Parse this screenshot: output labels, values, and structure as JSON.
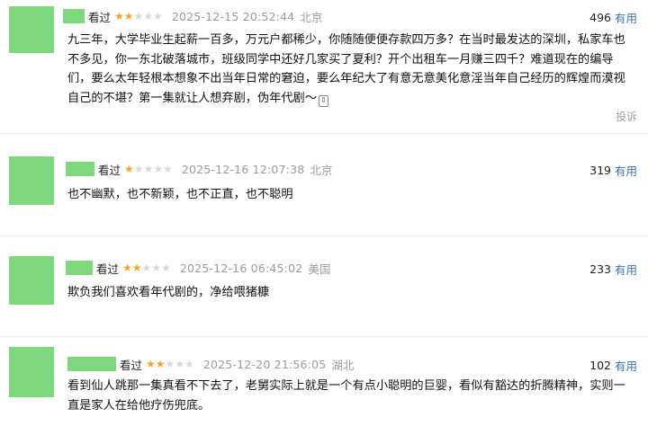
{
  "reviews": [
    {
      "status": "看过",
      "rating": 2,
      "time": "2025-12-15 20:52:44",
      "location": "北京",
      "votes": "496",
      "useful_label": "有用",
      "lines": [
        "九三年，大学毕业生起薪一百多，万元户都稀少，你随随便便存款四万多？在当时最发达的深圳，私家车也",
        "不多见，你一东北破落城市，班级同学中还好几家买了夏利？开个出租车一月赚三四千？难道现在的编导",
        "们，要么太年轻根本想象不出当年日常的窘迫，要么年纪大了有意无意美化意淫当年自己经历的辉煌而漠视",
        "自己的不堪？第一集就让人想弃剧，伪年代剧～"
      ],
      "report_label": "投诉"
    },
    {
      "status": "看过",
      "rating": 1,
      "time": "2025-12-16 12:07:38",
      "location": "北京",
      "votes": "319",
      "useful_label": "有用",
      "lines": [
        "也不幽默，也不新颖，也不正直，也不聪明"
      ]
    },
    {
      "status": "看过",
      "rating": 2,
      "time": "2025-12-16 06:45:02",
      "location": "美国",
      "votes": "233",
      "useful_label": "有用",
      "lines": [
        "欺负我们喜欢看年代剧的，净给喂猪糠"
      ]
    },
    {
      "status": "看过",
      "rating": 2,
      "time": "2025-12-20 21:56:05",
      "location": "湖北",
      "votes": "102",
      "useful_label": "有用",
      "lines": [
        "看到仙人跳那一集真看不下去了，老舅实际上就是一个有点小聪明的巨婴，看似有豁达的折腾精神，实则一",
        "直是家人在给他疗伤兜底。"
      ]
    }
  ]
}
